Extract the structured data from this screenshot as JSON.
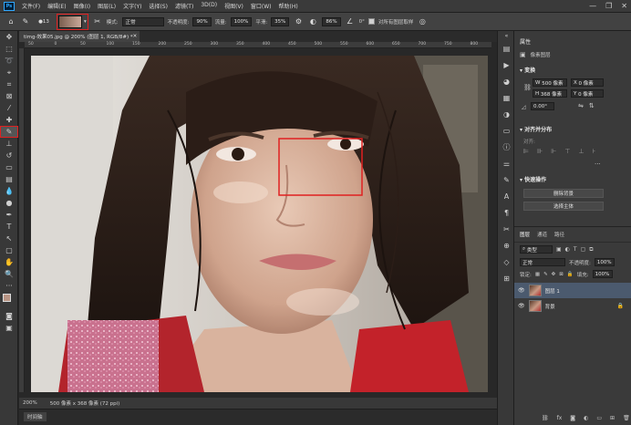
{
  "menubar": {
    "logo": "Ps",
    "items": [
      "文件(F)",
      "编辑(E)",
      "图像(I)",
      "图层(L)",
      "文字(Y)",
      "选择(S)",
      "滤镜(T)",
      "3D(D)",
      "视图(V)",
      "窗口(W)",
      "帮助(H)"
    ],
    "controls": [
      "—",
      "❐",
      "✕"
    ]
  },
  "options": {
    "brush_size": "13",
    "mode_label": "模式:",
    "mode_value": "正常",
    "opacity_label": "不透明度:",
    "opacity_value": "90%",
    "flow_label": "流量:",
    "flow_value": "100%",
    "smooth_label": "平滑:",
    "smooth_value": "35%",
    "angle_value": "0°",
    "sample_label": "对所有图层取样",
    "extra_value": "86%",
    "source_value": "0"
  },
  "document": {
    "tab_title": "timg-效果05.jpg @ 200% (图层 1, RGB/8#) *",
    "close": "✕"
  },
  "ruler": {
    "labels": [
      "50",
      "0",
      "50",
      "100",
      "150",
      "200",
      "250",
      "300",
      "350",
      "400",
      "450",
      "500",
      "550",
      "600",
      "650",
      "700",
      "750",
      "800"
    ]
  },
  "status": {
    "zoom": "200%",
    "doc_size": "500 像素 x 368 像素 (72 ppi)"
  },
  "timeline": {
    "label": "时间轴"
  },
  "properties": {
    "title": "属性",
    "kind": "像素图层",
    "transform_title": "变换",
    "w_label": "W",
    "w_value": "500 像素",
    "h_label": "H",
    "h_value": "368 像素",
    "x_value": "0 像素",
    "y_value": "0 像素",
    "angle_value": "0.00°",
    "align_title": "对齐并分布",
    "align_label": "对齐:",
    "quick_title": "快速操作",
    "remove_bg": "删除背景",
    "select_subject": "选择主体"
  },
  "layers_panel": {
    "tabs": [
      "图层",
      "通道",
      "路径"
    ],
    "filter_kind": "类型",
    "blend_mode": "正常",
    "opacity_label": "不透明度:",
    "opacity_value": "100%",
    "lock_label": "锁定:",
    "fill_label": "填充:",
    "fill_value": "100%",
    "layers": [
      {
        "name": "图层 1",
        "selected": true
      },
      {
        "name": "背景",
        "selected": false
      }
    ]
  }
}
